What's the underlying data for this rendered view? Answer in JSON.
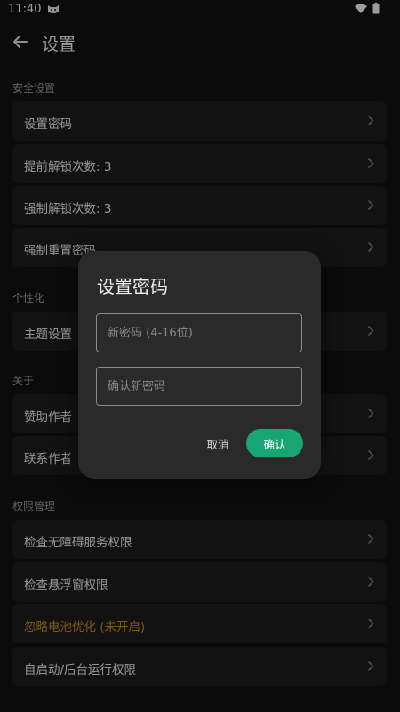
{
  "status_bar": {
    "time": "11:40"
  },
  "app_bar": {
    "title": "设置"
  },
  "sections": {
    "security": {
      "header": "安全设置",
      "items": [
        {
          "label": "设置密码"
        },
        {
          "label": "提前解锁次数: 3"
        },
        {
          "label": "强制解锁次数: 3"
        },
        {
          "label": "强制重置密码"
        }
      ]
    },
    "personalization": {
      "header": "个性化",
      "items": [
        {
          "label": "主题设置"
        }
      ]
    },
    "about": {
      "header": "关于",
      "items": [
        {
          "label": "赞助作者"
        },
        {
          "label": "联系作者"
        }
      ]
    },
    "permissions": {
      "header": "权限管理",
      "items": [
        {
          "label": "检查无障碍服务权限"
        },
        {
          "label": "检查悬浮窗权限"
        },
        {
          "label": "忽略电池优化 (未开启)"
        },
        {
          "label": "自启动/后台运行权限"
        }
      ]
    }
  },
  "dialog": {
    "title": "设置密码",
    "new_password": {
      "value": "",
      "placeholder": "新密码 (4-16位)"
    },
    "confirm_password": {
      "value": "",
      "placeholder": "确认新密码"
    },
    "cancel_label": "取消",
    "confirm_label": "确认"
  },
  "colors": {
    "background": "#111111",
    "row_background": "#1d1d1d",
    "dialog_background": "#2a2a2a",
    "accent": "#17a673",
    "warning_text": "#c8871f"
  },
  "icons": {
    "back": "arrow-left-icon",
    "chevron": "chevron-right-icon",
    "wifi": "wifi-icon",
    "battery": "battery-icon",
    "status_app": "cat-face-icon"
  }
}
